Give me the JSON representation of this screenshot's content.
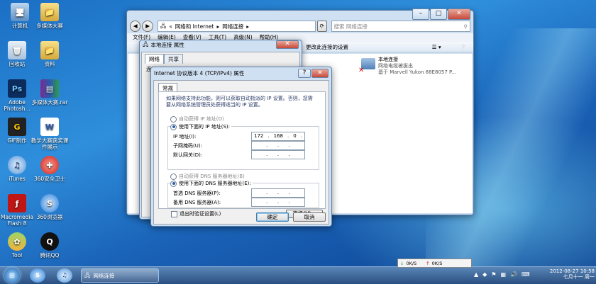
{
  "desktop_icons": [
    {
      "label": "计算机",
      "icon": "computer-icon"
    },
    {
      "label": "多媒体大赛",
      "icon": "folder-icon"
    },
    {
      "label": "回收站",
      "icon": "recycle-bin-icon"
    },
    {
      "label": "资料",
      "icon": "folder-icon"
    },
    {
      "label": "Adobe Photosh...",
      "icon": "photoshop-icon"
    },
    {
      "label": "多媒体大赛.rar",
      "icon": "rar-icon"
    },
    {
      "label": "GIF制作",
      "icon": "gif-icon"
    },
    {
      "label": "教学大赛获奖课件展示",
      "icon": "document-icon"
    },
    {
      "label": "iTunes",
      "icon": "itunes-icon"
    },
    {
      "label": "360安全卫士",
      "icon": "shield-icon"
    },
    {
      "label": "Macromedia Flash 8",
      "icon": "flash-icon"
    },
    {
      "label": "360浏览器",
      "icon": "browser-icon"
    },
    {
      "label": "Tool",
      "icon": "tool-icon"
    },
    {
      "label": "腾讯QQ",
      "icon": "qq-icon"
    }
  ],
  "explorer": {
    "breadcrumb": [
      "«",
      "网络和 Internet",
      "▸",
      "网络连接",
      "▸"
    ],
    "search_placeholder": "搜索 网络连接",
    "menu": [
      "文件(F)",
      "编辑(E)",
      "查看(V)",
      "工具(T)",
      "高级(N)",
      "帮助(H)"
    ],
    "toolbar_text": "更改此连接的设置",
    "adapter": {
      "name": "本地连接",
      "status": "网络电缆被拔出",
      "device": "基于 Marvell Yukon 88E8057 P..."
    }
  },
  "props_window": {
    "title": "本地连接 属性",
    "tabs": [
      "网络",
      "共享"
    ],
    "connect_label": "连接时使用:"
  },
  "ipv4_dialog": {
    "title": "Internet 协议版本 4 (TCP/IPv4) 属性",
    "help": "?",
    "tab": "常规",
    "description": "如果网络支持此功能，则可以获取自动指派的 IP 设置。否则，您需要从网络系统管理员处获得适当的 IP 设置。",
    "auto_ip": "自动获得 IP 地址(O)",
    "manual_ip": "使用下面的 IP 地址(S):",
    "ip_label": "IP 地址(I):",
    "ip_value": [
      "172",
      ".",
      "168",
      ".",
      "0",
      "."
    ],
    "mask_label": "子网掩码(U):",
    "gateway_label": "默认网关(D):",
    "auto_dns": "自动获得 DNS 服务器地址(B)",
    "manual_dns": "使用下面的 DNS 服务器地址(E):",
    "dns1_label": "首选 DNS 服务器(P):",
    "dns2_label": "备用 DNS 服务器(A):",
    "dot": ".",
    "validate": "退出时验证设置(L)",
    "advanced": "高级(V)...",
    "ok": "确定",
    "cancel": "取消"
  },
  "taskbar": {
    "active_task": "网络连接",
    "net_down": "0K/S",
    "net_up": "0K/S",
    "time": "10:58",
    "date": "2012-08-27",
    "weekday": "七月十一 周一"
  }
}
